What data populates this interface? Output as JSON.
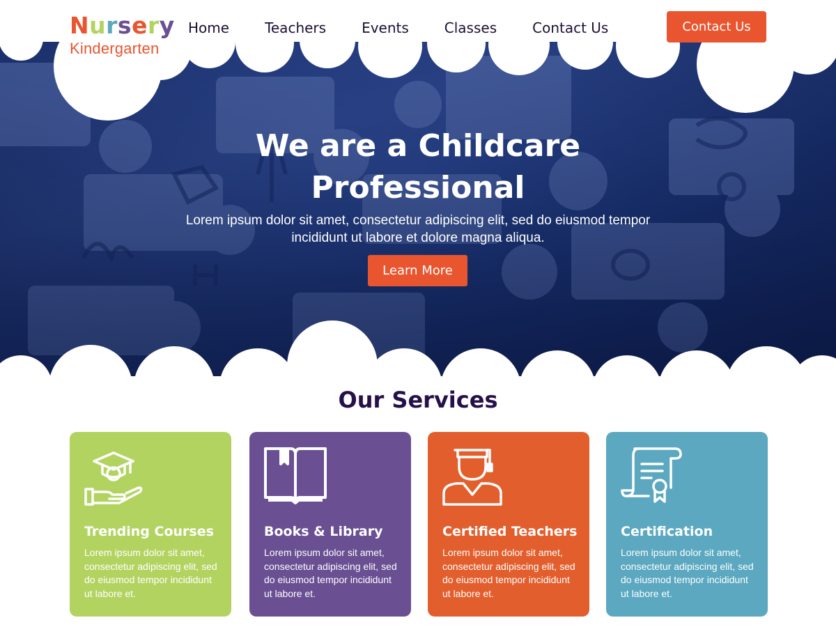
{
  "logo": {
    "letters": [
      {
        "char": "N",
        "color": "#e8552f"
      },
      {
        "char": "u",
        "color": "#b3d361"
      },
      {
        "char": "r",
        "color": "#5ba8c0"
      },
      {
        "char": "s",
        "color": "#6a4f92"
      },
      {
        "char": "e",
        "color": "#e8552f"
      },
      {
        "char": "r",
        "color": "#b3d361"
      },
      {
        "char": "y",
        "color": "#6a4f92"
      }
    ],
    "subtitle": "Kindergarten"
  },
  "nav": {
    "items": [
      "Home",
      "Teachers",
      "Events",
      "Classes",
      "Contact Us"
    ]
  },
  "header": {
    "cta_label": "Contact Us"
  },
  "hero": {
    "title": "We are a Childcare Professional",
    "subtitle": "Lorem ipsum dolor sit amet, consectetur adipiscing elit, sed do eiusmod tempor incididunt ut labore et dolore magna aliqua.",
    "button_label": "Learn More"
  },
  "services": {
    "title": "Our Services",
    "cards": [
      {
        "title": "Trending Courses",
        "text": "Lorem ipsum dolor sit amet, consectetur adipiscing elit, sed do eiusmod tempor incididunt ut labore et.",
        "color": "#b3d361",
        "icon": "graduation-hand-icon"
      },
      {
        "title": "Books & Library",
        "text": "Lorem ipsum dolor sit amet, consectetur adipiscing elit, sed do eiusmod tempor incididunt ut labore et.",
        "color": "#6a4f92",
        "icon": "open-book-icon"
      },
      {
        "title": "Certified Teachers",
        "text": "Lorem ipsum dolor sit amet, consectetur adipiscing elit, sed do eiusmod tempor incididunt ut labore et.",
        "color": "#e35e2d",
        "icon": "graduate-teacher-icon"
      },
      {
        "title": "Certification",
        "text": "Lorem ipsum dolor sit amet, consectetur adipiscing elit, sed do eiusmod tempor incididunt ut labore et.",
        "color": "#5ba8c0",
        "icon": "certificate-scroll-icon"
      }
    ]
  },
  "colors": {
    "accent": "#e8552f",
    "heading": "#25104a",
    "nav_text": "#1b1035"
  }
}
